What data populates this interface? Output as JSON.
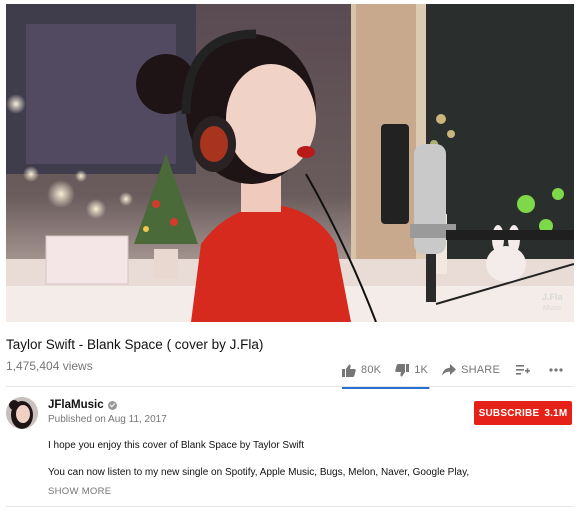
{
  "video": {
    "watermark": "J.Fla\nMusic",
    "headphone_brand": "beats"
  },
  "info": {
    "title": "Taylor Swift - Blank Space ( cover by J.Fla)",
    "views": "1,475,404 views",
    "likes": "80K",
    "dislikes": "1K",
    "share_label": "SHARE",
    "like_ratio": 0.987
  },
  "channel": {
    "name": "JFlaMusic",
    "published": "Published on Aug 11, 2017",
    "subscribe_label": "SUBSCRIBE",
    "subscriber_count": "3.1M"
  },
  "description": {
    "line1": "I hope you enjoy this cover of Blank Space by Taylor Swift",
    "line2": "You can now listen to my new single on Spotify, Apple Music, Bugs, Melon, Naver, Google Play,",
    "show_more": "SHOW MORE"
  },
  "icons": {
    "like": "thumbs-up-icon",
    "dislike": "thumbs-down-icon",
    "share": "share-arrow-icon",
    "add": "add-to-playlist-icon",
    "more": "more-dots-icon",
    "verified": "verified-check-icon"
  },
  "colors": {
    "subscribe": "#e62117",
    "sentiment": "#2a6fd6",
    "meta": "#767676"
  }
}
